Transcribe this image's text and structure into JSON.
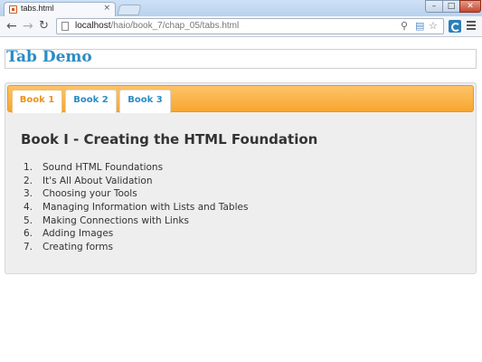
{
  "browser": {
    "tab_title": "tabs.html",
    "tab_close": "×",
    "url_host": "localhost",
    "url_path": "/haio/book_7/chap_05/tabs.html",
    "window_controls": [
      "–",
      "□",
      "✕"
    ],
    "nav_icons": {
      "back": "back-arrow-icon",
      "forward": "forward-arrow-icon",
      "reload": "reload-icon",
      "search": "search-icon",
      "star": "bookmark-star-icon",
      "menu": "menu-icon"
    }
  },
  "page": {
    "title": "Tab Demo",
    "tabs": [
      {
        "label": "Book 1",
        "active": true
      },
      {
        "label": "Book 2",
        "active": false
      },
      {
        "label": "Book 3",
        "active": false
      }
    ],
    "panel": {
      "heading": "Book I - Creating the HTML Foundation",
      "items": [
        {
          "num": "1.",
          "text": "Sound HTML Foundations"
        },
        {
          "num": "2.",
          "text": "It's All About Validation"
        },
        {
          "num": "3.",
          "text": "Choosing your Tools"
        },
        {
          "num": "4.",
          "text": "Managing Information with Lists and Tables"
        },
        {
          "num": "5.",
          "text": "Making Connections with Links"
        },
        {
          "num": "6.",
          "text": "Adding Images"
        },
        {
          "num": "7.",
          "text": "Creating forms"
        }
      ]
    }
  },
  "colors": {
    "title_blue": "#2a8cc4",
    "tab_bar_orange": "#f8a62d",
    "active_tab_text": "#e8941e",
    "panel_bg": "#eeeeee"
  }
}
